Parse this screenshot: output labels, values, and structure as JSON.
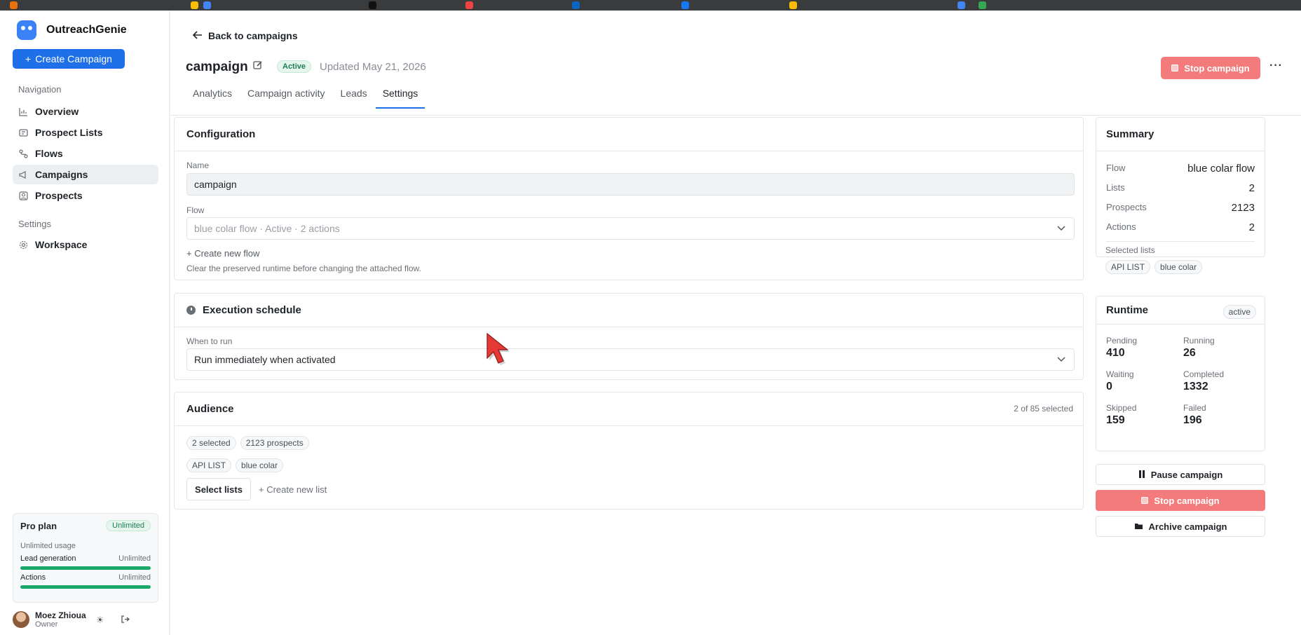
{
  "brand": {
    "name": "OutreachGenie"
  },
  "sidebar": {
    "create_label": "Create Campaign",
    "nav_heading": "Navigation",
    "items": [
      {
        "label": "Overview",
        "icon": "chart-icon"
      },
      {
        "label": "Prospect Lists",
        "icon": "list-icon"
      },
      {
        "label": "Flows",
        "icon": "flow-icon"
      },
      {
        "label": "Campaigns",
        "icon": "megaphone-icon",
        "active": true
      },
      {
        "label": "Prospects",
        "icon": "user-icon"
      }
    ],
    "settings_heading": "Settings",
    "settings_items": [
      {
        "label": "Workspace",
        "icon": "gear-icon"
      }
    ],
    "plan": {
      "title": "Pro plan",
      "badge": "Unlimited",
      "subtitle": "Unlimited usage",
      "rows": [
        {
          "label": "Lead generation",
          "value": "Unlimited",
          "fill": 1.0
        },
        {
          "label": "Actions",
          "value": "Unlimited",
          "fill": 1.0
        }
      ]
    },
    "user": {
      "name": "Moez Zhioua",
      "role": "Owner"
    }
  },
  "header": {
    "back_label": "Back to campaigns",
    "title": "campaign",
    "status_badge": "Active",
    "updated": "Updated May 21, 2026",
    "stop_label": "Stop campaign",
    "more": "···"
  },
  "tabs": [
    "Analytics",
    "Campaign activity",
    "Leads",
    "Settings"
  ],
  "active_tab": "Settings",
  "configuration": {
    "title": "Configuration",
    "name_label": "Name",
    "name_value": "campaign",
    "flow_label": "Flow",
    "flow_value": "blue colar flow · Active · 2 actions",
    "create_flow": "Create new flow",
    "hint": "Clear the preserved runtime before changing the attached flow."
  },
  "schedule": {
    "title": "Execution schedule",
    "when_label": "When to run",
    "when_value": "Run immediately when activated"
  },
  "audience": {
    "title": "Audience",
    "selected_count": "2 of 85 selected",
    "chips": [
      "2 selected",
      "2123 prospects"
    ],
    "lists": [
      "API LIST",
      "blue colar"
    ],
    "select_lists": "Select lists",
    "create_list": "Create new list"
  },
  "summary": {
    "title": "Summary",
    "rows": [
      {
        "label": "Flow",
        "value": "blue colar flow"
      },
      {
        "label": "Lists",
        "value": "2"
      },
      {
        "label": "Prospects",
        "value": "2123"
      },
      {
        "label": "Actions",
        "value": "2"
      }
    ],
    "selected_lists_label": "Selected lists",
    "selected_lists": [
      "API LIST",
      "blue colar"
    ]
  },
  "runtime": {
    "title": "Runtime",
    "badge": "active",
    "stats": [
      {
        "label": "Pending",
        "value": "410"
      },
      {
        "label": "Running",
        "value": "26"
      },
      {
        "label": "Waiting",
        "value": "0"
      },
      {
        "label": "Completed",
        "value": "1332"
      },
      {
        "label": "Skipped",
        "value": "159"
      },
      {
        "label": "Failed",
        "value": "196"
      }
    ]
  },
  "actions": {
    "pause": "Pause campaign",
    "stop": "Stop campaign",
    "archive": "Archive campaign"
  },
  "colors": {
    "primary": "#1e6fe8",
    "danger": "#f47b7b",
    "success": "#1aa86a"
  }
}
